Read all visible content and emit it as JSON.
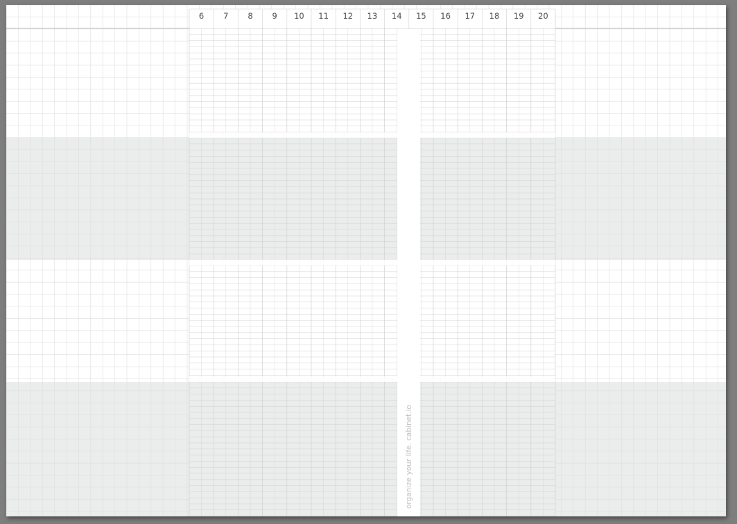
{
  "planner": {
    "hours": [
      "6",
      "7",
      "8",
      "9",
      "10",
      "11",
      "12",
      "13",
      "14",
      "15",
      "16",
      "17",
      "18",
      "19",
      "20"
    ],
    "watermark": "organize your life. cabinet.io"
  },
  "colors": {
    "page_background": "#7e7e7e",
    "paper": "#ffffff",
    "shaded_band": "#ebecec",
    "grid_line": "#dedede",
    "schedule_grid_line": "#cfcfcf",
    "header_rule": "#bcbcbc",
    "hour_label": "#444444",
    "watermark_text": "#bdbdbd"
  }
}
